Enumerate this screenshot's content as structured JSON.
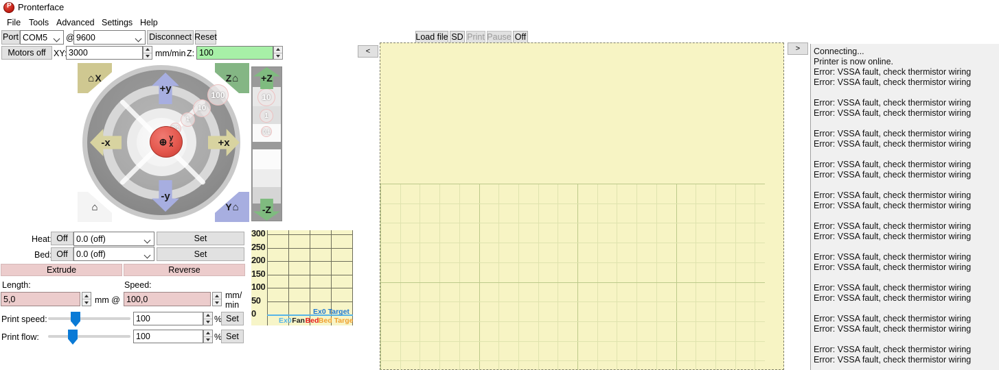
{
  "window": {
    "title": "Pronterface",
    "icon": "pronterface-logo-icon"
  },
  "menu": [
    {
      "label": "File"
    },
    {
      "label": "Tools"
    },
    {
      "label": "Advanced"
    },
    {
      "label": "Settings"
    },
    {
      "label": "Help"
    }
  ],
  "connection": {
    "port_label": "Port",
    "port_value": "COM5",
    "at_label": "@",
    "baud_value": "9600",
    "disconnect_label": "Disconnect",
    "reset_label": "Reset"
  },
  "speeds": {
    "motors_off_label": "Motors off",
    "xy_label": "XY:",
    "xy_value": "3000",
    "units_label": "mm/min",
    "z_label": "Z:",
    "z_value": "100"
  },
  "print_toolbar": {
    "load_file_label": "Load file",
    "sd_label": "SD",
    "print_label": "Print",
    "pause_label": "Pause",
    "off_label": "Off"
  },
  "panel_toggles": {
    "collapse_left_label": "<",
    "collapse_right_label": ">"
  },
  "jog": {
    "center_label_o": "⊕",
    "center_label_y": "y",
    "center_label_x": "x",
    "plus_y": "+y",
    "minus_y": "-y",
    "plus_x": "+x",
    "minus_x": "-x",
    "home_x": "X",
    "home_z": "Z",
    "home_y": "Y",
    "home_all": "",
    "steps": [
      "0.1",
      "1",
      "10",
      "100"
    ]
  },
  "zjog": {
    "plus_z": "+Z",
    "minus_z": "-Z",
    "steps": [
      "10",
      "1",
      "0.1"
    ]
  },
  "temps": {
    "heat_label": "Heat:",
    "heat_off_label": "Off",
    "heat_value": "0.0 (off)",
    "heat_set_label": "Set",
    "bed_label": "Bed:",
    "bed_off_label": "Off",
    "bed_value": "0.0 (off)",
    "bed_set_label": "Set"
  },
  "extruder": {
    "extrude_label": "Extrude",
    "reverse_label": "Reverse",
    "length_label": "Length:",
    "length_value": "5,0",
    "mm_at_label": "mm @",
    "speed_label": "Speed:",
    "speed_value": "100,0",
    "speed_units_line1": "mm/",
    "speed_units_line2": "min"
  },
  "print_tuning": {
    "speed_label": "Print speed:",
    "speed_value": "100",
    "speed_percent": "%",
    "speed_set_label": "Set",
    "flow_label": "Print flow:",
    "flow_value": "100",
    "flow_percent": "%",
    "flow_set_label": "Set"
  },
  "chart_data": {
    "type": "line",
    "title": "",
    "xlabel": "",
    "ylabel": "",
    "ylim": [
      0,
      300
    ],
    "yticks": [
      "300",
      "250",
      "200",
      "150",
      "100",
      "50",
      "0"
    ],
    "grid": true,
    "legend_position": "bottom",
    "series": [
      {
        "name": "Ex0",
        "color": "#56b4e8",
        "values": [
          0,
          0,
          0,
          0,
          0,
          0
        ]
      },
      {
        "name": "Fan",
        "color": "#1c1c1c",
        "values": [
          0,
          0,
          0,
          0,
          0,
          0
        ]
      },
      {
        "name": "Bed",
        "color": "#e81a1a",
        "values": [
          0,
          0,
          0,
          0,
          0,
          0
        ]
      },
      {
        "name": "Bed Target",
        "color": "#f0a030",
        "values": [
          0,
          0,
          0,
          0,
          0,
          0
        ]
      },
      {
        "name": "Ex0 Target",
        "color": "#1e78d2",
        "values": [
          0,
          0,
          0,
          0,
          0,
          0
        ]
      }
    ]
  },
  "console": {
    "lines": [
      "Connecting...",
      "Printer is now online.",
      "Error: VSSA fault, check thermistor wiring",
      "Error: VSSA fault, check thermistor wiring",
      "",
      "Error: VSSA fault, check thermistor wiring",
      "Error: VSSA fault, check thermistor wiring",
      "",
      "Error: VSSA fault, check thermistor wiring",
      "Error: VSSA fault, check thermistor wiring",
      "",
      "Error: VSSA fault, check thermistor wiring",
      "Error: VSSA fault, check thermistor wiring",
      "",
      "Error: VSSA fault, check thermistor wiring",
      "Error: VSSA fault, check thermistor wiring",
      "",
      "Error: VSSA fault, check thermistor wiring",
      "Error: VSSA fault, check thermistor wiring",
      "",
      "Error: VSSA fault, check thermistor wiring",
      "Error: VSSA fault, check thermistor wiring",
      "",
      "Error: VSSA fault, check thermistor wiring",
      "Error: VSSA fault, check thermistor wiring",
      "",
      "Error: VSSA fault, check thermistor wiring",
      "Error: VSSA fault, check thermistor wiring",
      "",
      "Error: VSSA fault, check thermistor wiring",
      "Error: VSSA fault, check thermistor wiring"
    ]
  },
  "colors": {
    "accent_green": "#a7f0a7",
    "extruder_pink": "#eccccc",
    "slider_blue": "#0a7ad6",
    "viewer_bg": "#f7f4c4",
    "jog_center_red": "#e4584e"
  }
}
